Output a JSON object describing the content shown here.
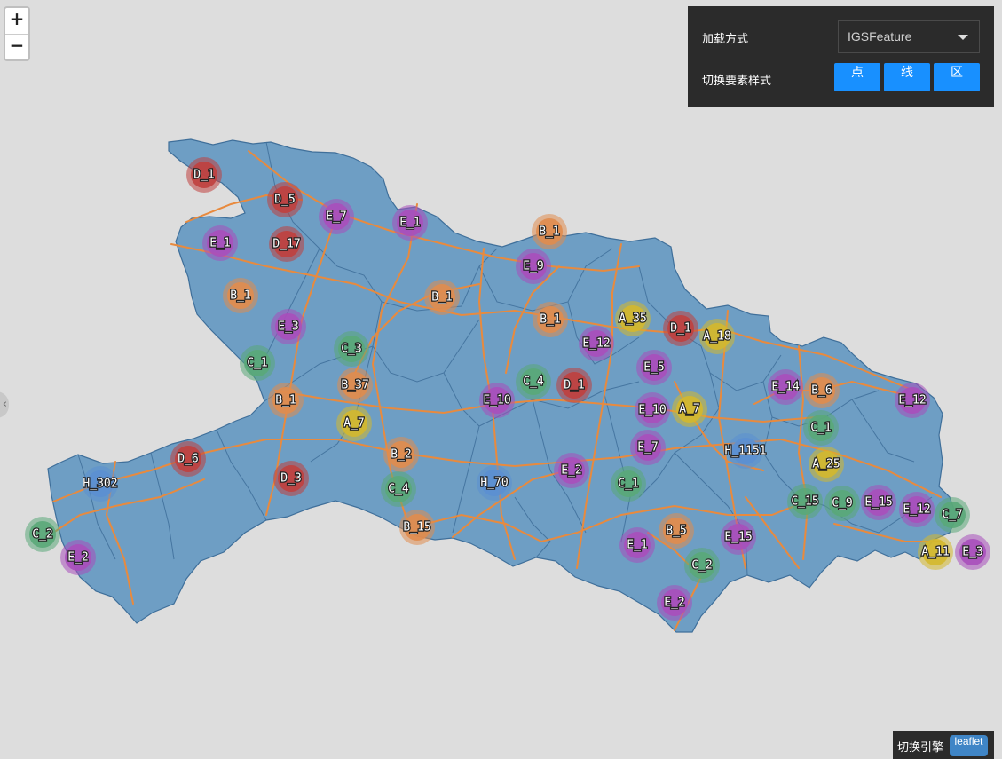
{
  "zoom": {
    "in_label": "+",
    "out_label": "−"
  },
  "panel": {
    "load_label": "加载方式",
    "load_value": "IGSFeature",
    "style_label": "切换要素样式",
    "buttons": [
      "点",
      "线",
      "区"
    ],
    "button_color": "#1890ff"
  },
  "engine": {
    "label": "切换引擎",
    "value": "leaflet"
  },
  "colors": {
    "region_fill": "#6e9ec4",
    "region_border": "#3f6f9a",
    "road": "#e88a3e",
    "background": "#dddddd",
    "A": "#d4b82e",
    "B": "#e08c4e",
    "C": "#5aa879",
    "D": "#c0403e",
    "E": "#a84fbb",
    "H": "#5b8fd1"
  },
  "clusters": [
    {
      "label": "D_1",
      "cat": "D"
    },
    {
      "label": "D_5",
      "cat": "D"
    },
    {
      "label": "E_7",
      "cat": "E"
    },
    {
      "label": "E_1",
      "cat": "E"
    },
    {
      "label": "B_1",
      "cat": "B"
    },
    {
      "label": "E_1",
      "cat": "E"
    },
    {
      "label": "D_17",
      "cat": "D"
    },
    {
      "label": "E_9",
      "cat": "E"
    },
    {
      "label": "B_1",
      "cat": "B"
    },
    {
      "label": "B_1",
      "cat": "B"
    },
    {
      "label": "B_1",
      "cat": "B"
    },
    {
      "label": "A_35",
      "cat": "A"
    },
    {
      "label": "D_1",
      "cat": "D"
    },
    {
      "label": "E_12",
      "cat": "E"
    },
    {
      "label": "A_18",
      "cat": "A"
    },
    {
      "label": "E_3",
      "cat": "E"
    },
    {
      "label": "C_3",
      "cat": "C"
    },
    {
      "label": "C_1",
      "cat": "C"
    },
    {
      "label": "E_5",
      "cat": "E"
    },
    {
      "label": "C_4",
      "cat": "C"
    },
    {
      "label": "D_1",
      "cat": "D"
    },
    {
      "label": "E_14",
      "cat": "E"
    },
    {
      "label": "B_6",
      "cat": "B"
    },
    {
      "label": "E_12",
      "cat": "E"
    },
    {
      "label": "B_37",
      "cat": "B"
    },
    {
      "label": "B_1",
      "cat": "B"
    },
    {
      "label": "E_10",
      "cat": "E"
    },
    {
      "label": "A_7",
      "cat": "A"
    },
    {
      "label": "E_10",
      "cat": "E"
    },
    {
      "label": "A_7",
      "cat": "A"
    },
    {
      "label": "C_1",
      "cat": "C"
    },
    {
      "label": "E_7",
      "cat": "E"
    },
    {
      "label": "H_1151",
      "cat": "H"
    },
    {
      "label": "D_6",
      "cat": "D"
    },
    {
      "label": "B_2",
      "cat": "B"
    },
    {
      "label": "A_25",
      "cat": "A"
    },
    {
      "label": "E_2",
      "cat": "E"
    },
    {
      "label": "H_302",
      "cat": "H"
    },
    {
      "label": "D_3",
      "cat": "D"
    },
    {
      "label": "C_4",
      "cat": "C"
    },
    {
      "label": "H_70",
      "cat": "H"
    },
    {
      "label": "C_1",
      "cat": "C"
    },
    {
      "label": "C_15",
      "cat": "C"
    },
    {
      "label": "C_9",
      "cat": "C"
    },
    {
      "label": "E_15",
      "cat": "E"
    },
    {
      "label": "E_12",
      "cat": "E"
    },
    {
      "label": "C_7",
      "cat": "C"
    },
    {
      "label": "B_15",
      "cat": "B"
    },
    {
      "label": "B_5",
      "cat": "B"
    },
    {
      "label": "E_15",
      "cat": "E"
    },
    {
      "label": "C_2",
      "cat": "C"
    },
    {
      "label": "E_1",
      "cat": "E"
    },
    {
      "label": "A_11",
      "cat": "A"
    },
    {
      "label": "E_3",
      "cat": "E"
    },
    {
      "label": "E_2",
      "cat": "E"
    },
    {
      "label": "C_2",
      "cat": "C"
    },
    {
      "label": "E_2",
      "cat": "E"
    }
  ]
}
